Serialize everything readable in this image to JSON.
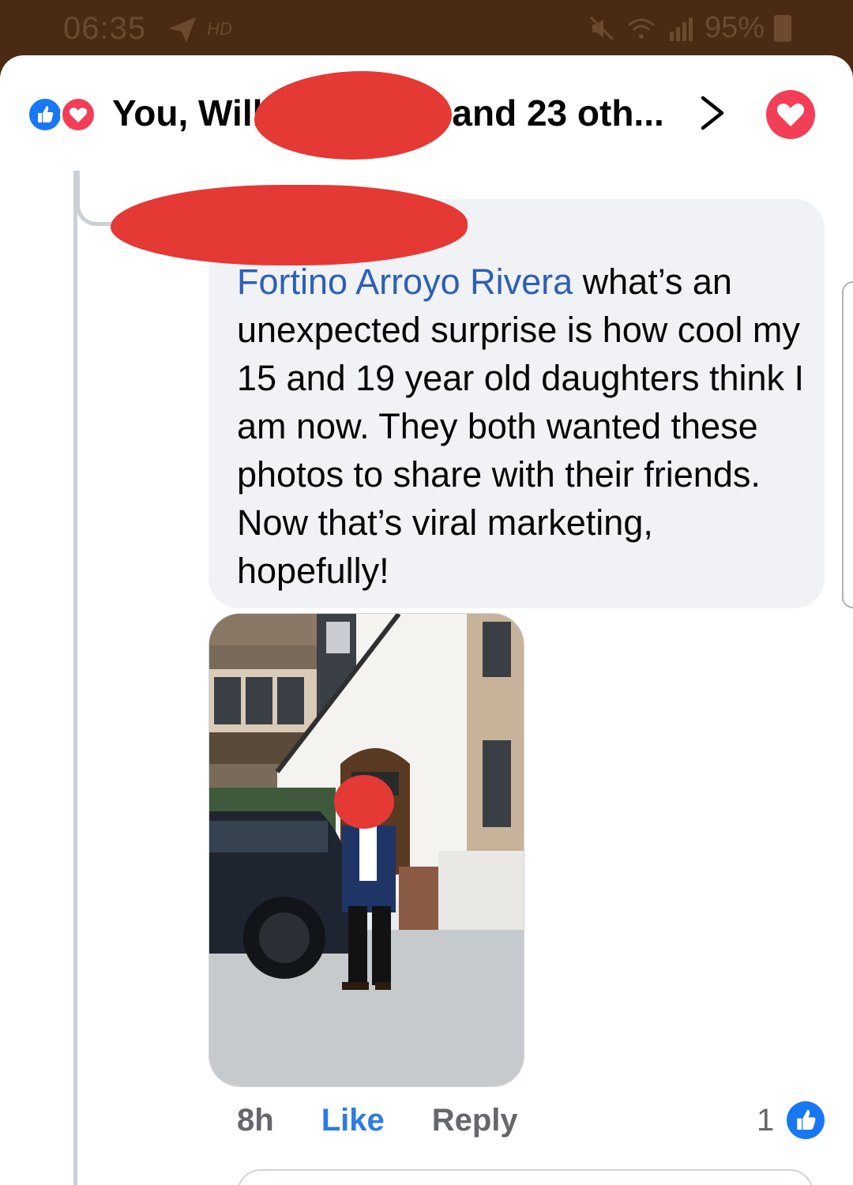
{
  "status_bar": {
    "time": "06:35",
    "hd_label": "HD",
    "battery": "95%",
    "icons": [
      "navigation-arrow-icon",
      "hd-voice-icon",
      "mute-icon",
      "wifi-icon",
      "signal-icon",
      "battery-icon"
    ]
  },
  "reactions_header": {
    "text_start": "You, Will",
    "text_end": "and 23 oth...",
    "reaction_icons": [
      "like-icon",
      "love-icon"
    ],
    "chevron": "chevron-right-icon",
    "user_reaction": "love-icon"
  },
  "comment": {
    "mention": "Fortino Arroyo Rivera",
    "text": " what’s an unexpected surprise is how cool my 15 and 19 year old daughters think I am now. They both wanted these photos to share with their friends. Now that’s viral marketing, hopefully!",
    "time": "8h",
    "like_label": "Like",
    "reply_label": "Reply",
    "like_count": "1"
  },
  "colors": {
    "status_bar_bg": "#4a2a12",
    "mention": "#2d5fb8",
    "like_blue": "#1877f2",
    "love_red": "#f33e58",
    "redaction": "#e53935",
    "bubble_bg": "#f0f2f5"
  }
}
